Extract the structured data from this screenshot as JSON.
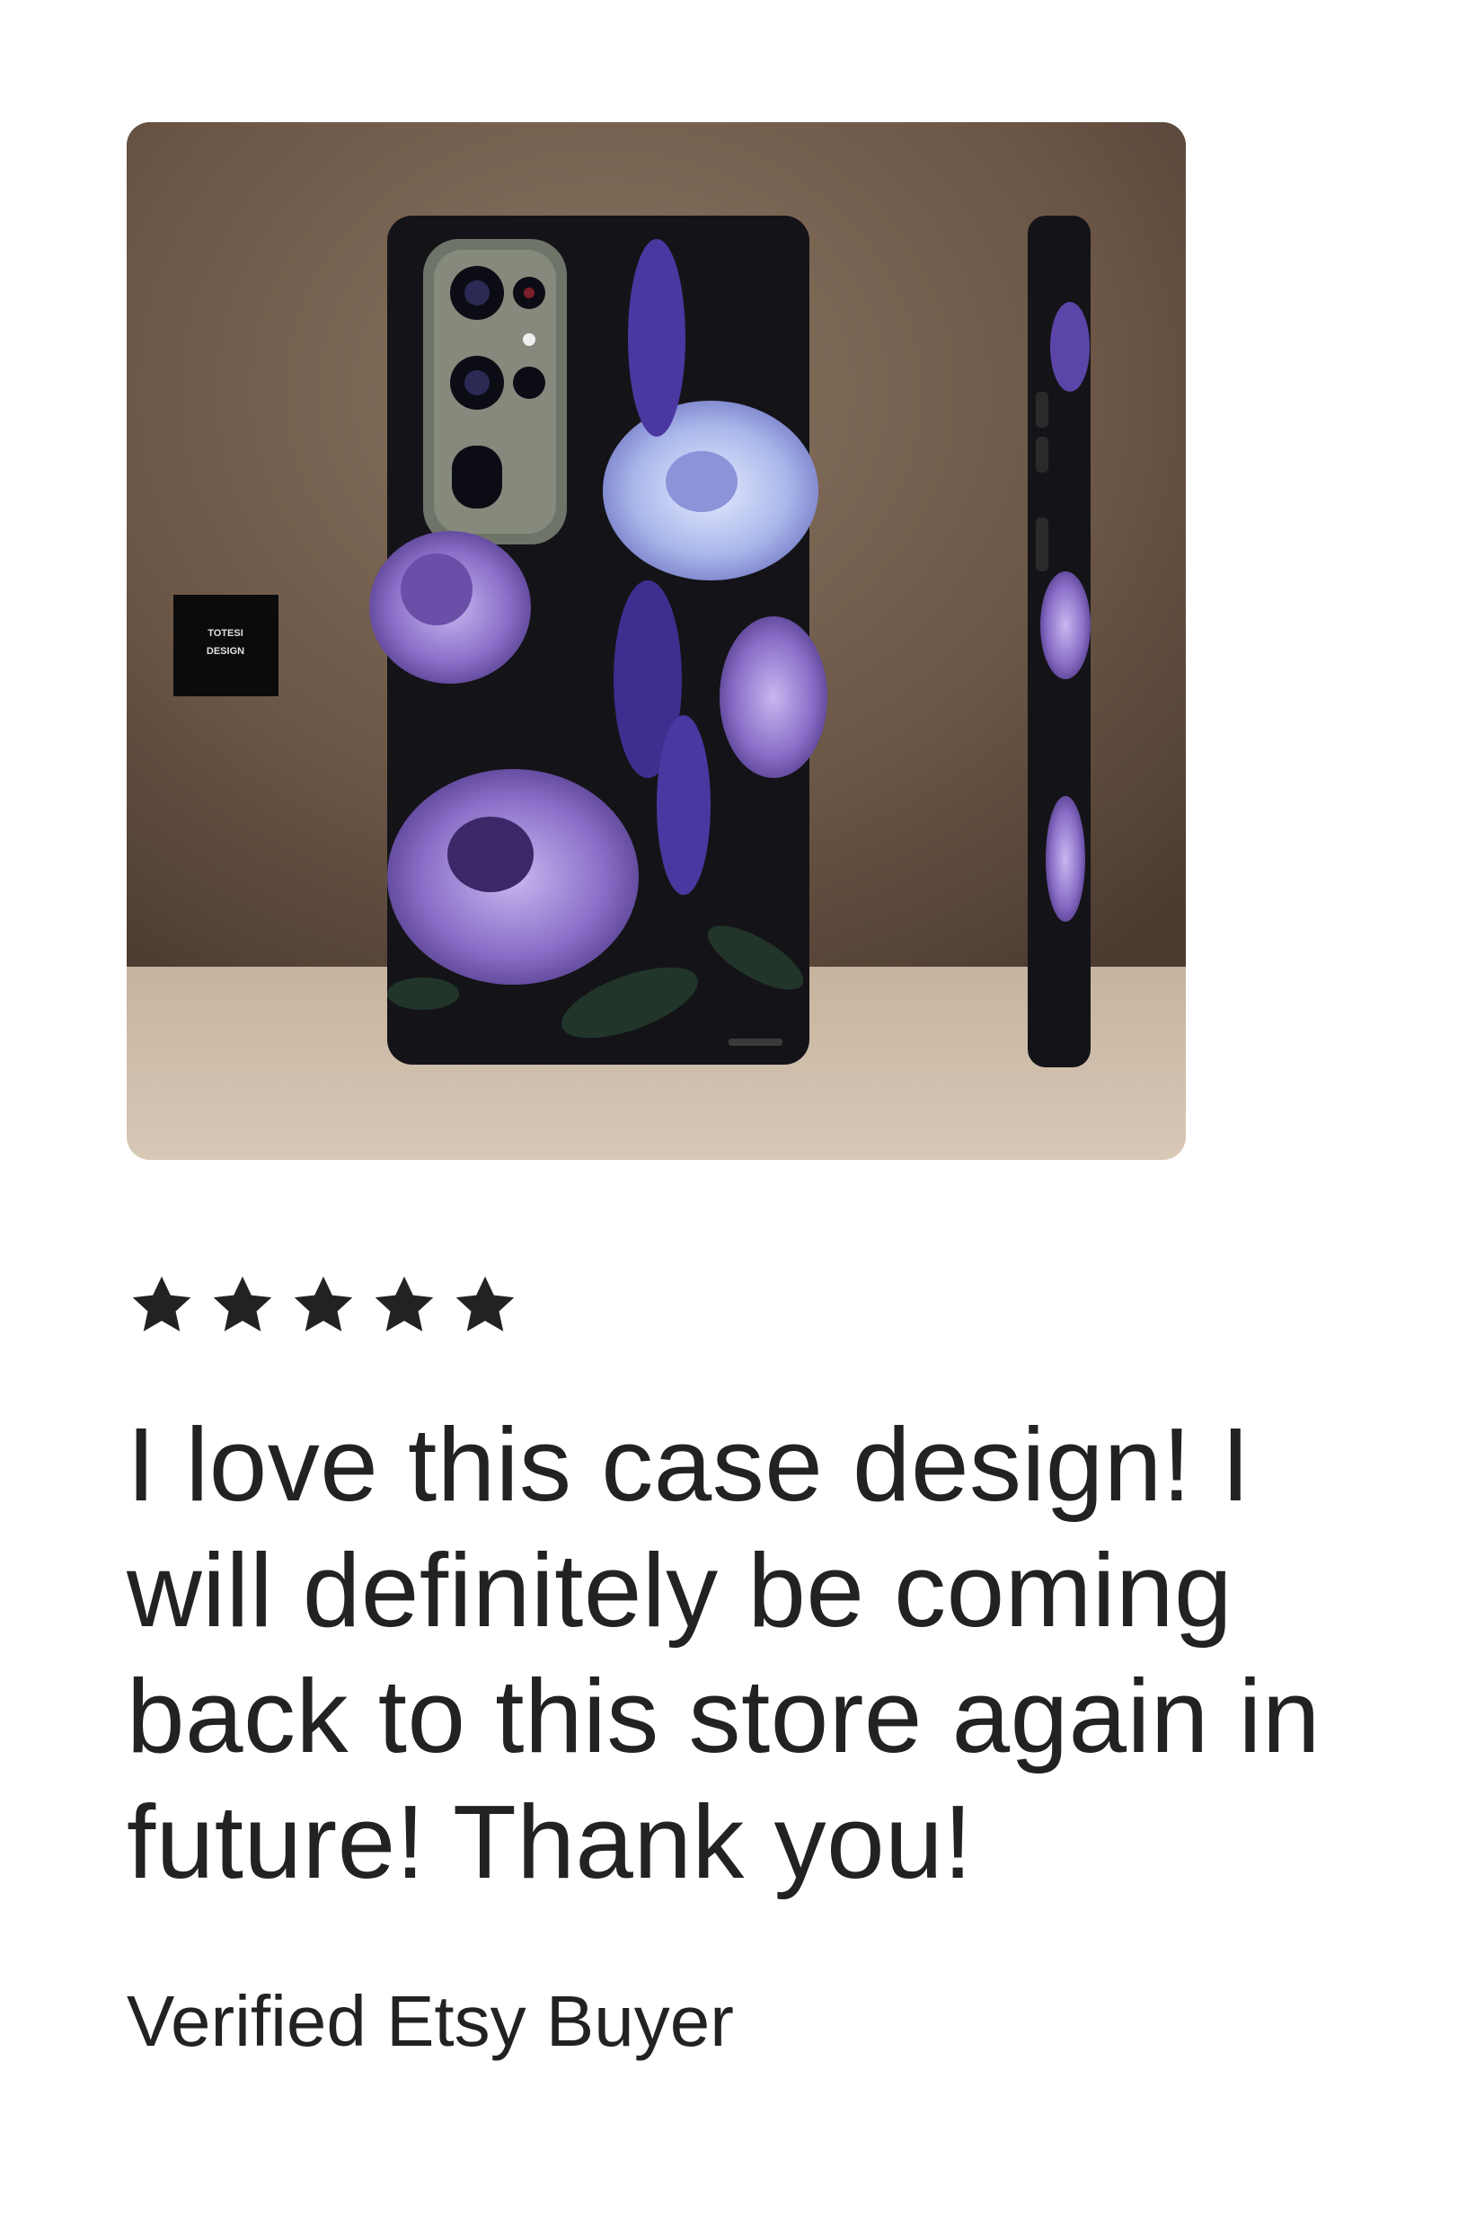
{
  "product": {
    "logo_text_line1": "TOTESI",
    "logo_text_line2": "DESIGN"
  },
  "review": {
    "rating": 5,
    "rating_max": 5,
    "text": "I love this case design! I will definitely be coming back to this store again in future! Thank you!",
    "author": "Verified Etsy Buyer"
  },
  "colors": {
    "text": "#222222",
    "star": "#222222",
    "background": "#ffffff"
  }
}
